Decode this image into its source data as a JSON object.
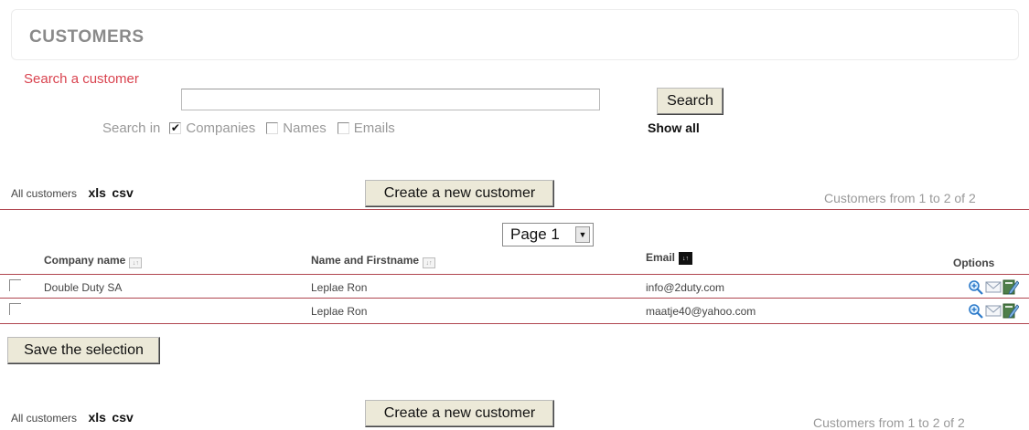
{
  "title": "CUSTOMERS",
  "search": {
    "label": "Search a customer",
    "value": "",
    "button": "Search",
    "show_all": "Show all",
    "search_in_label": "Search in",
    "options": [
      {
        "label": "Companies",
        "checked": true
      },
      {
        "label": "Names",
        "checked": false
      },
      {
        "label": "Emails",
        "checked": false
      }
    ]
  },
  "toolbar_top": {
    "all_customers": "All customers",
    "xls": "xls",
    "csv": "csv",
    "create_button": "Create a new customer",
    "count_text": "Customers from 1 to 2 of 2"
  },
  "pagination": {
    "selected": "Page 1"
  },
  "table": {
    "columns": [
      "Company name",
      "Name and Firstname",
      "Email",
      "Options"
    ],
    "rows": [
      {
        "company": "Double Duty SA",
        "name": "Leplae Ron",
        "email": "info@2duty.com"
      },
      {
        "company": "",
        "name": "Leplae Ron",
        "email": "maatje40@yahoo.com"
      }
    ]
  },
  "save_button": "Save the selection",
  "toolbar_bottom": {
    "all_customers": "All customers",
    "xls": "xls",
    "csv": "csv",
    "create_button": "Create a new customer",
    "count_text": "Customers from 1 to 2 of 2"
  },
  "colors": {
    "accent_red": "#d9434f",
    "rule": "#b0454f"
  },
  "icons": [
    "zoom-icon",
    "mail-icon",
    "edit-icon",
    "sort-icon",
    "dropdown-arrow-icon"
  ]
}
